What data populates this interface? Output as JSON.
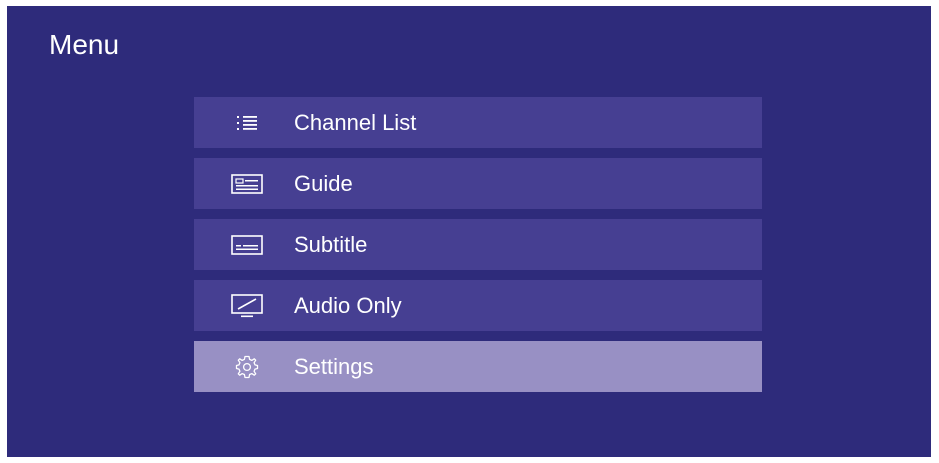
{
  "header": {
    "title": "Menu"
  },
  "menu": {
    "items": [
      {
        "label": "Channel List",
        "icon": "list-icon",
        "selected": false
      },
      {
        "label": "Guide",
        "icon": "guide-icon",
        "selected": false
      },
      {
        "label": "Subtitle",
        "icon": "subtitle-icon",
        "selected": false
      },
      {
        "label": "Audio Only",
        "icon": "audio-only-icon",
        "selected": false
      },
      {
        "label": "Settings",
        "icon": "gear-icon",
        "selected": true
      }
    ]
  },
  "colors": {
    "background": "#2e2b7b",
    "item_background": "#463f92",
    "item_selected_background": "#9890c4",
    "text": "#ffffff"
  }
}
